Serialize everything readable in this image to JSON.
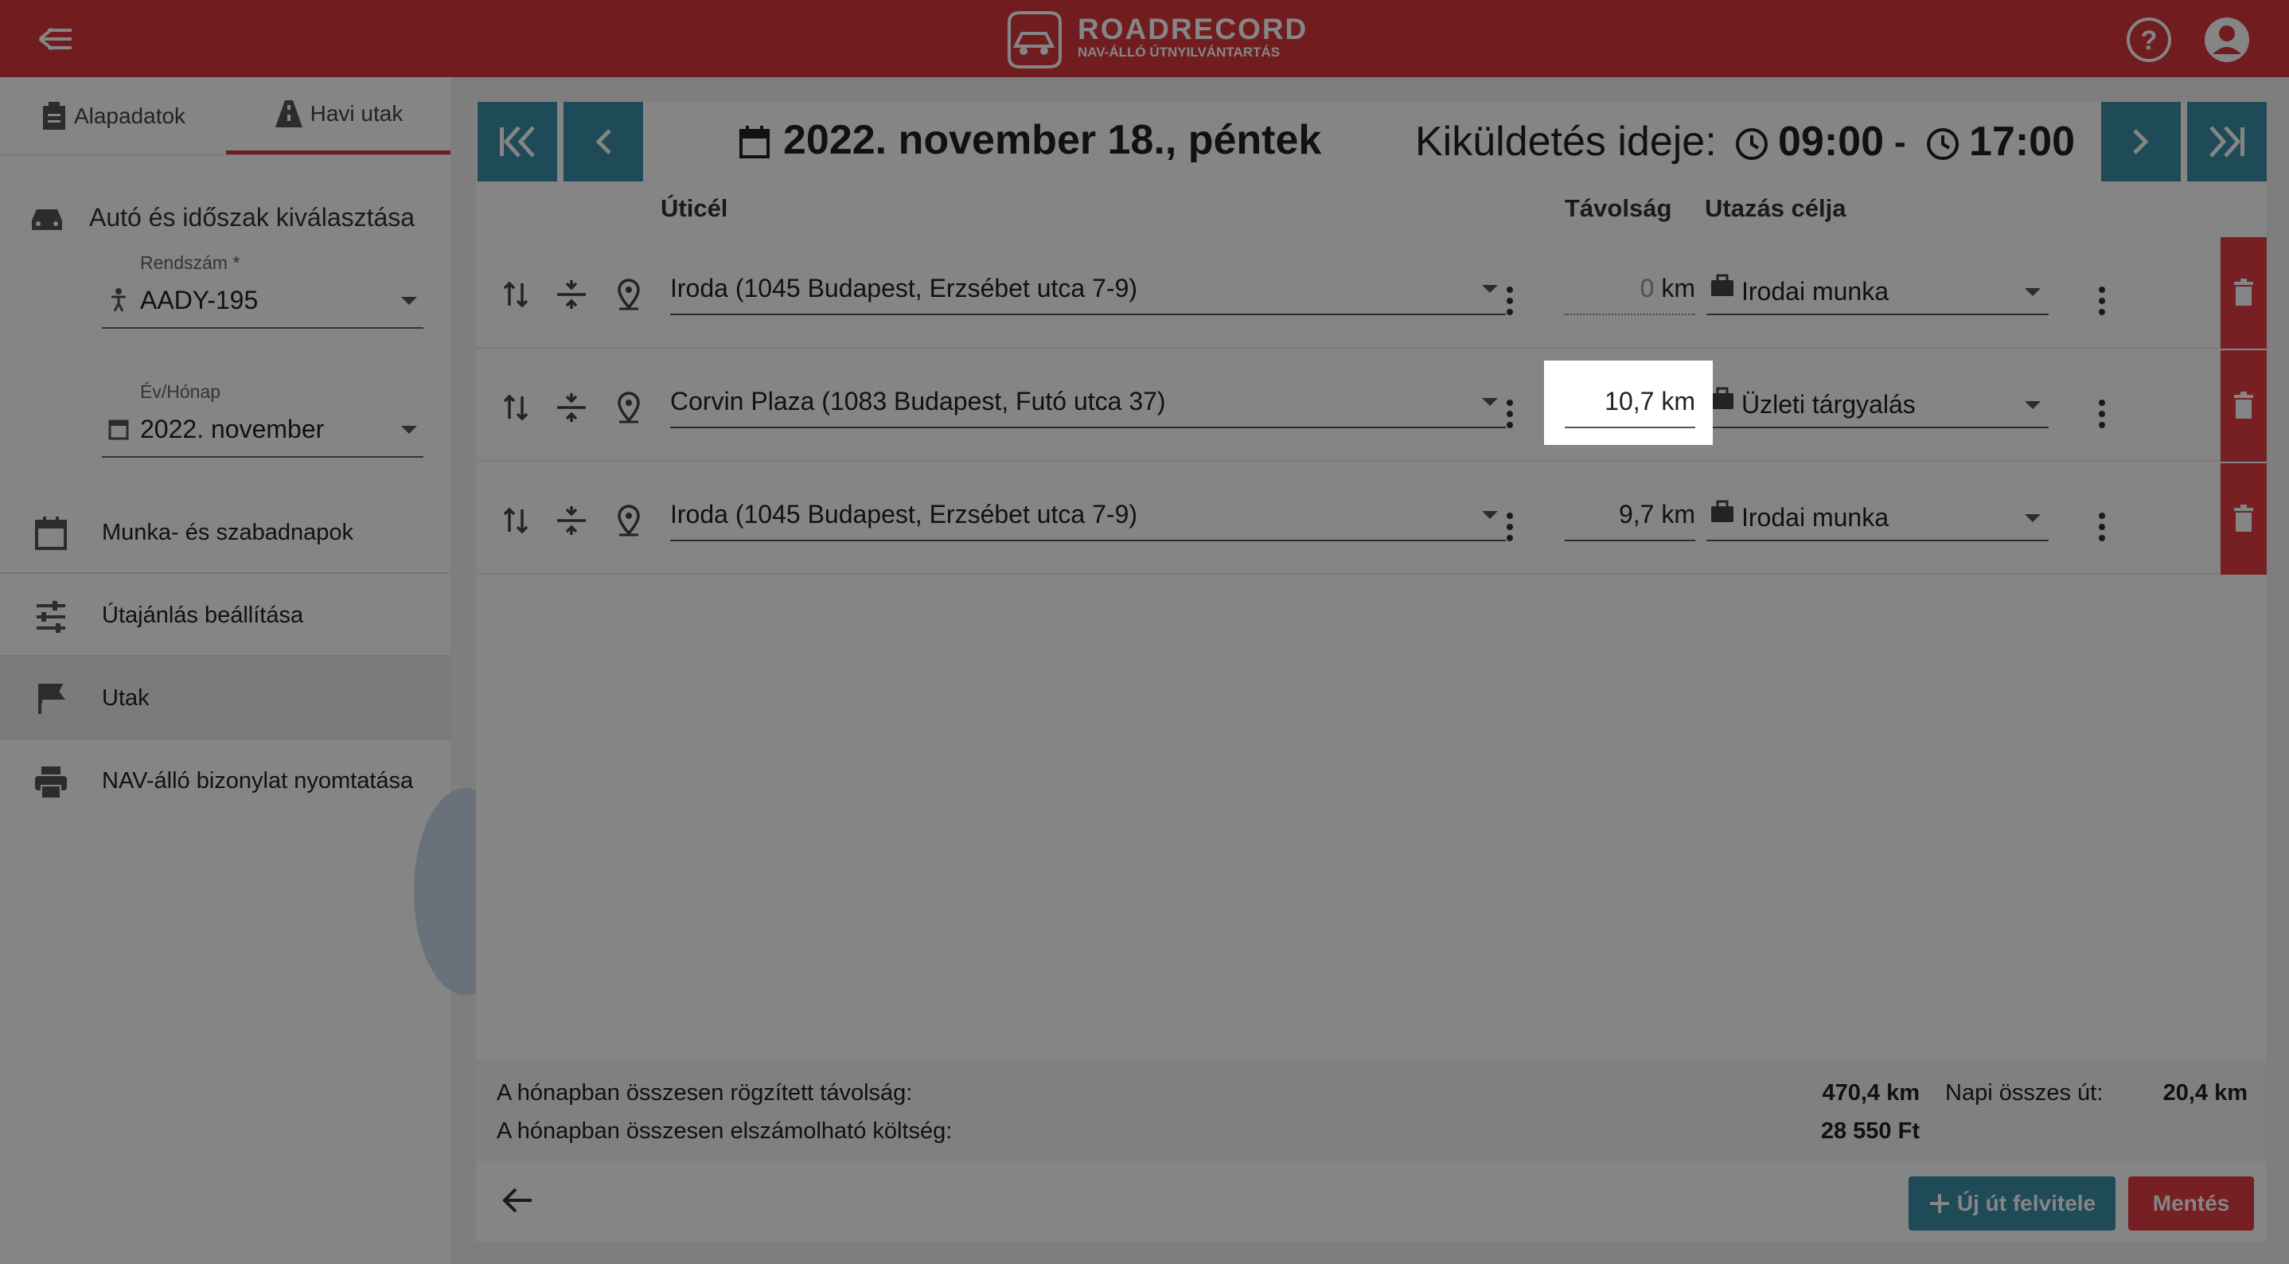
{
  "header": {
    "logo_title": "ROADRECORD",
    "logo_subtitle": "NAV-ÁLLÓ ÚTNYILVÁNTARTÁS"
  },
  "left_panel": {
    "tabs": [
      {
        "label": "Alapadatok",
        "icon": "clipboard-icon"
      },
      {
        "label": "Havi utak",
        "icon": "road-icon",
        "active": true
      }
    ],
    "section_title": "Autó és időszak kiválasztása",
    "plate_field": {
      "label": "Rendszám *",
      "value": "AADY-195"
    },
    "month_field": {
      "label": "Év/Hónap",
      "value": "2022. november"
    },
    "menu": [
      {
        "label": "Munka- és szabadnapok",
        "icon": "calendar-icon"
      },
      {
        "label": "Útajánlás beállítása",
        "icon": "sliders-icon"
      },
      {
        "label": "Utak",
        "icon": "flag-icon",
        "active": true
      },
      {
        "label": "NAV-álló bizonylat nyomtatása",
        "icon": "printer-icon"
      }
    ]
  },
  "main": {
    "date": "2022. november 18., péntek",
    "kikuldetes_label": "Kiküldetés ideje:",
    "time_start": "09:00",
    "time_sep": "-",
    "time_end": "17:00",
    "columns": {
      "destination": "Úticél",
      "distance": "Távolság",
      "purpose": "Utazás célja"
    },
    "rows": [
      {
        "destination": "Iroda (1045 Budapest, Erzsébet utca 7-9)",
        "distance": "0",
        "unit": "km",
        "purpose": "Irodai munka"
      },
      {
        "destination": "Corvin Plaza (1083 Budapest, Futó utca 37)",
        "distance": "10,7",
        "unit": "km",
        "purpose": "Üzleti tárgyalás"
      },
      {
        "destination": "Iroda (1045 Budapest, Erzsébet utca 7-9)",
        "distance": "9,7",
        "unit": "km",
        "purpose": "Irodai munka"
      }
    ],
    "summary": {
      "total_distance_label": "A hónapban összesen rögzített távolság:",
      "total_distance_value": "470,4 km",
      "total_cost_label": "A hónapban összesen elszámolható költség:",
      "total_cost_value": "28 550 Ft",
      "daily_label": "Napi összes út:",
      "daily_value": "20,4 km"
    },
    "buttons": {
      "new_trip": "Új út felvitele",
      "save": "Mentés"
    }
  },
  "colors": {
    "header": "#d9393f",
    "accent": "#3a91a8",
    "danger": "#e23f45"
  }
}
